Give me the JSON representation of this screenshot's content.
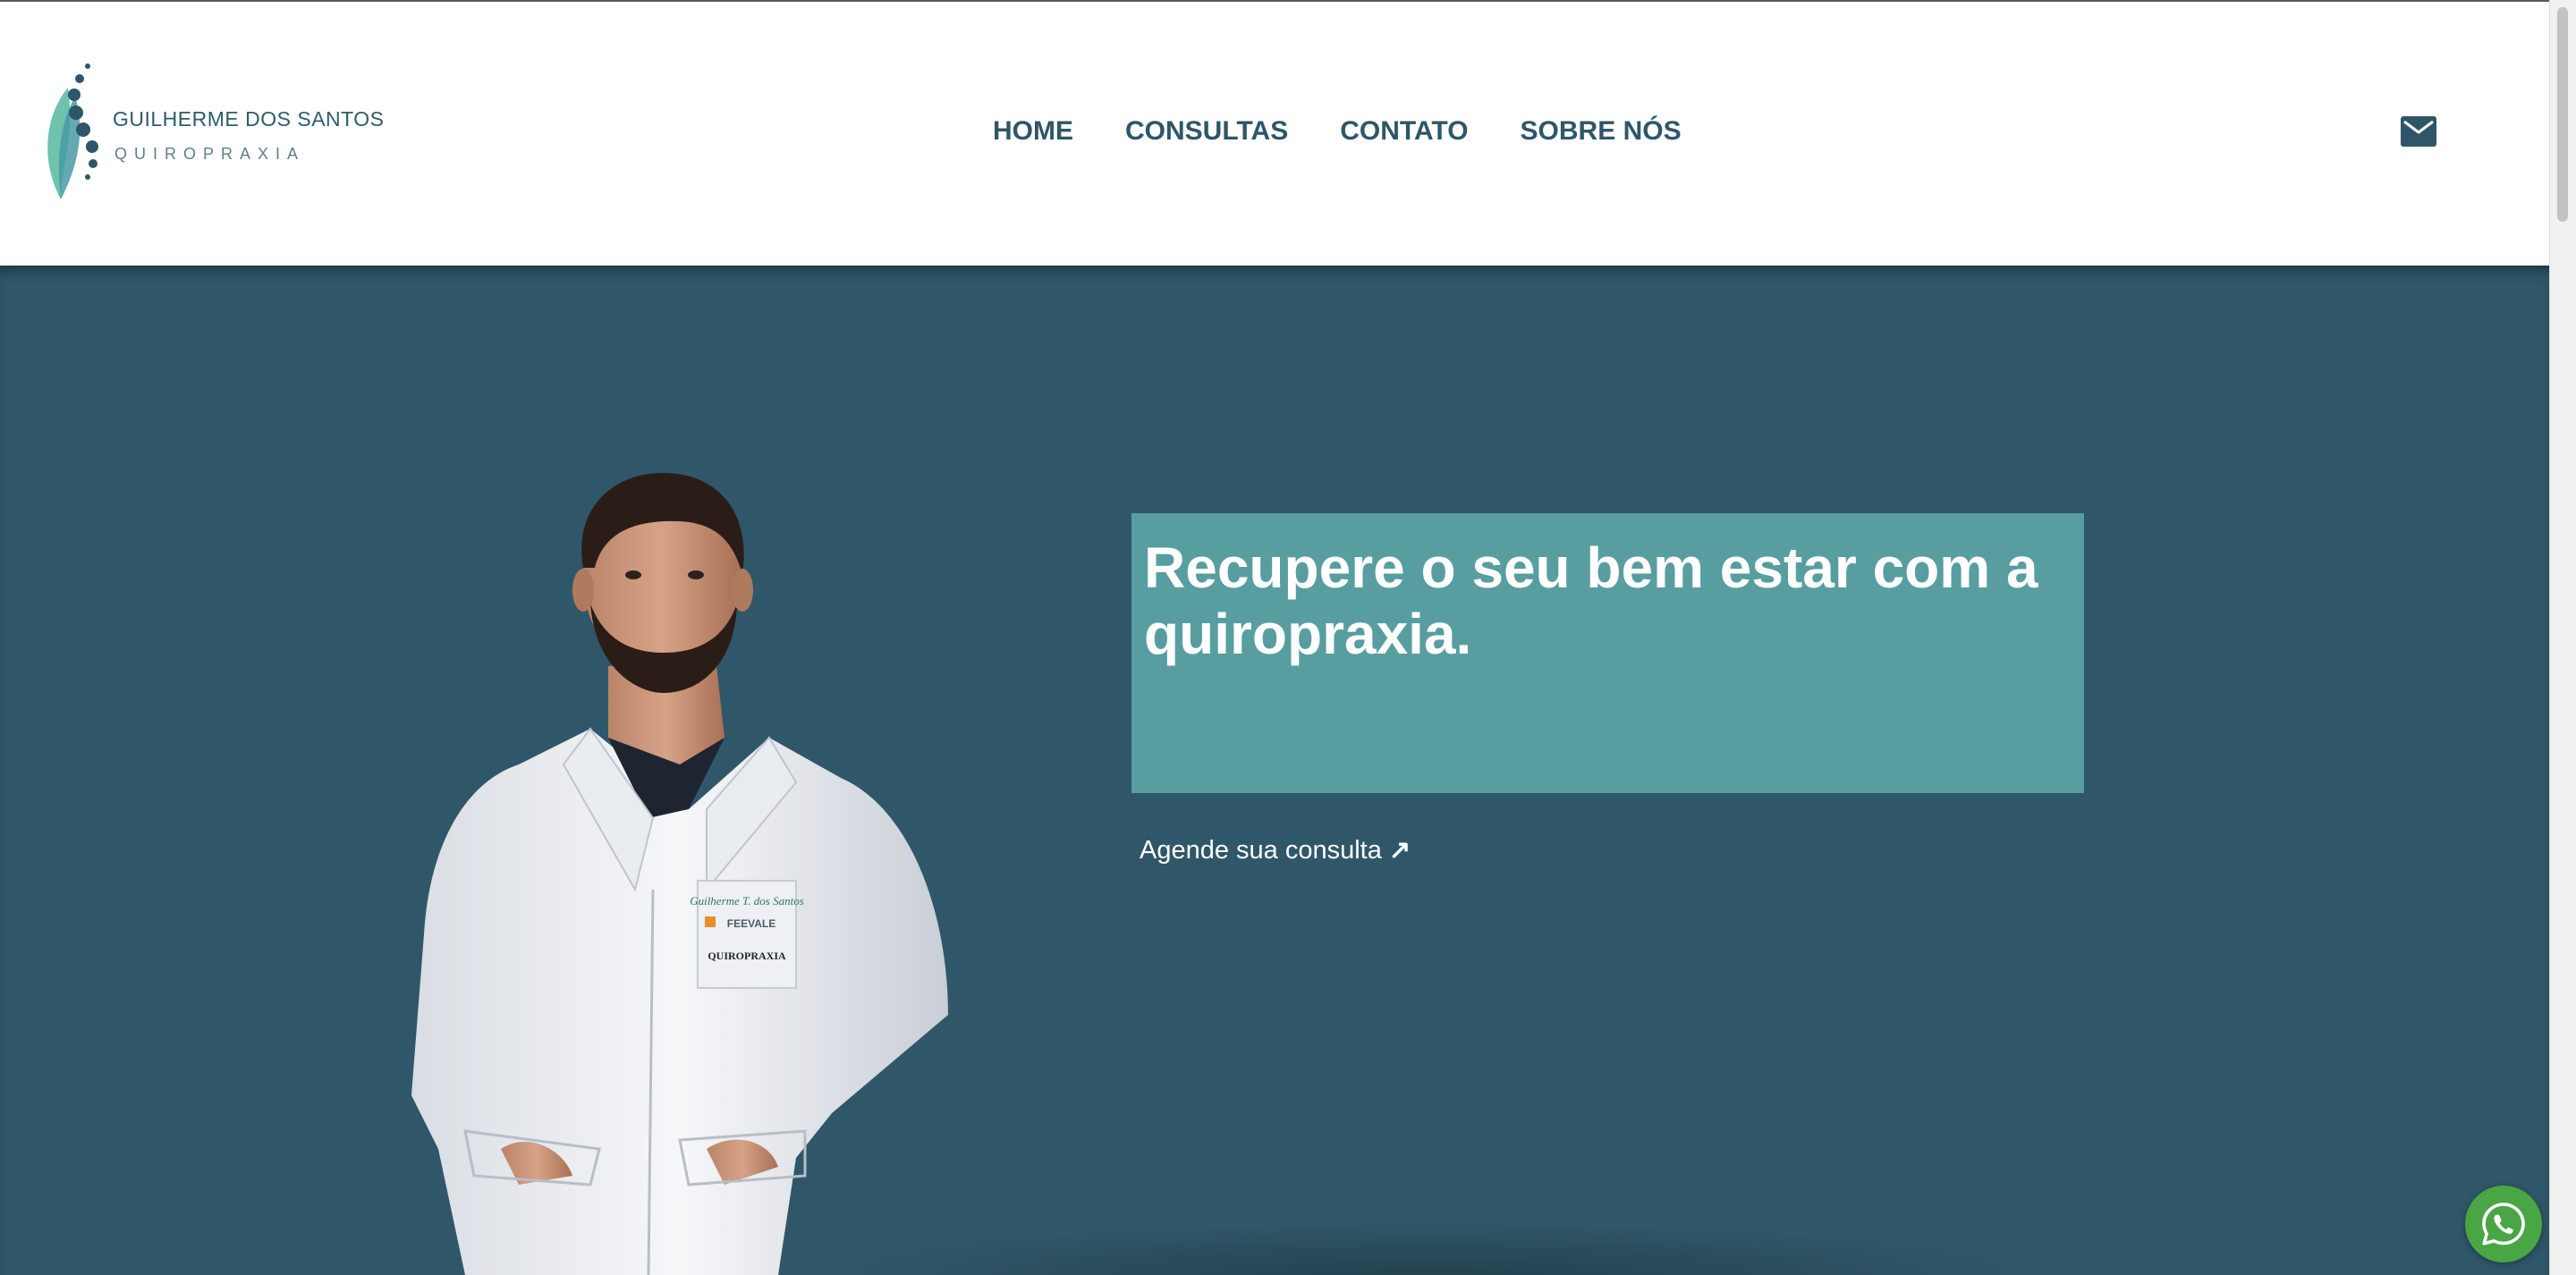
{
  "brand": {
    "name": "GUILHERME DOS SANTOS",
    "tagline": "QUIROPRAXIA",
    "logo_icon": "spine-leaf-logo-icon"
  },
  "nav": {
    "items": [
      {
        "label": "HOME"
      },
      {
        "label": "CONSULTAS"
      },
      {
        "label": "CONTATO"
      },
      {
        "label": "SOBRE NÓS"
      }
    ],
    "mail_icon": "mail-icon"
  },
  "hero": {
    "headline": "Recupere o seu bem estar com a quiropraxia.",
    "cta_label": "Agende sua consulta",
    "cta_arrow": "↗",
    "image": "chiropractor-portrait",
    "coat_badge": {
      "name": "Guilherme T. dos Santos",
      "school": "FEEVALE",
      "course": "QUIROPRAXIA"
    }
  },
  "floating": {
    "whatsapp_icon": "whatsapp-icon"
  },
  "colors": {
    "header_bg": "#ffffff",
    "nav_text": "#2e5668",
    "hero_bg": "#2f5769",
    "headline_box": "#589ea0",
    "whatsapp": "#4aa544"
  }
}
